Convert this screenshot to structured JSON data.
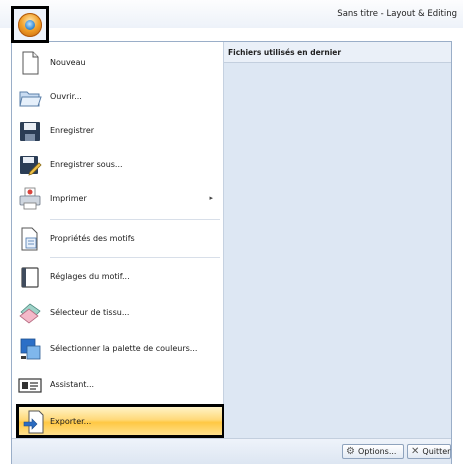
{
  "window": {
    "title": "Sans titre - Layout & Editing"
  },
  "recent": {
    "title": "Fichiers utilisés en dernier"
  },
  "menu": {
    "items": [
      {
        "label": "Nouveau",
        "icon": "new-document-icon"
      },
      {
        "label": "Ouvrir...",
        "icon": "open-folder-icon"
      },
      {
        "label": "Enregistrer",
        "icon": "save-icon"
      },
      {
        "label": "Enregistrer sous...",
        "icon": "save-as-icon"
      },
      {
        "label": "Imprimer",
        "icon": "printer-icon",
        "submenu": "▸"
      },
      {
        "label": "Propriétés des motifs",
        "icon": "properties-icon"
      },
      {
        "label": "Réglages du motif...",
        "icon": "design-settings-icon"
      },
      {
        "label": "Sélecteur de tissu...",
        "icon": "fabric-selector-icon"
      },
      {
        "label": "Sélectionner la palette de couleurs...",
        "icon": "color-palette-icon"
      },
      {
        "label": "Assistant...",
        "icon": "wizard-icon"
      },
      {
        "label": "Exporter...",
        "icon": "export-icon"
      }
    ]
  },
  "footer": {
    "options_label": "Options...",
    "quit_label": "Quitter"
  }
}
